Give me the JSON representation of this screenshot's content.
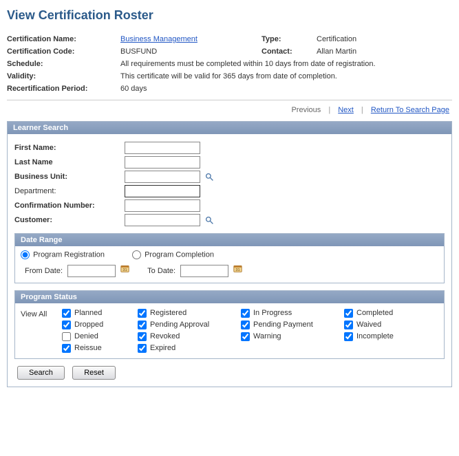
{
  "page_title": "View Certification Roster",
  "details": {
    "cert_name_label": "Certification Name:",
    "cert_name_value": "Business Management",
    "type_label": "Type:",
    "type_value": "Certification",
    "cert_code_label": "Certification Code:",
    "cert_code_value": "BUSFUND",
    "contact_label": "Contact:",
    "contact_value": "Allan Martin",
    "schedule_label": "Schedule:",
    "schedule_value": "All requirements must be completed within 10 days from date of registration.",
    "validity_label": "Validity:",
    "validity_value": "This certificate will be valid for 365 days from date of completion.",
    "recert_label": "Recertification Period:",
    "recert_value": "60 days"
  },
  "pager": {
    "previous": "Previous",
    "next": "Next",
    "return": "Return To Search Page"
  },
  "learner_search": {
    "header": "Learner Search",
    "first_name_label": "First Name:",
    "last_name_label": "Last Name",
    "business_unit_label": "Business Unit:",
    "department_label": "Department:",
    "confirmation_label": "Confirmation Number:",
    "customer_label": "Customer:",
    "first_name_value": "",
    "last_name_value": "",
    "business_unit_value": "",
    "department_value": "",
    "confirmation_value": "",
    "customer_value": ""
  },
  "date_range": {
    "header": "Date Range",
    "radio_registration": "Program Registration",
    "radio_completion": "Program Completion",
    "from_label": "From Date:",
    "to_label": "To Date:",
    "from_value": "",
    "to_value": ""
  },
  "program_status": {
    "header": "Program Status",
    "view_all": "View All",
    "options": {
      "planned": "Planned",
      "registered": "Registered",
      "in_progress": "In Progress",
      "completed": "Completed",
      "dropped": "Dropped",
      "pending_approval": "Pending Approval",
      "pending_payment": "Pending Payment",
      "waived": "Waived",
      "denied": "Denied",
      "revoked": "Revoked",
      "warning": "Warning",
      "incomplete": "Incomplete",
      "reissue": "Reissue",
      "expired": "Expired"
    }
  },
  "buttons": {
    "search": "Search",
    "reset": "Reset"
  }
}
